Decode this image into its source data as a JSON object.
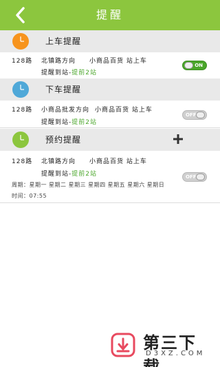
{
  "header": {
    "title": "提醒"
  },
  "sections": [
    {
      "title": "上车提醒",
      "clock_color": "#f7941d",
      "item": {
        "route": "128路",
        "direction": "北镇路方向",
        "station": "小商品百货 站上车",
        "remind_label": "提醒到站-",
        "remind_value": "提前2站",
        "toggle": "ON"
      }
    },
    {
      "title": "下车提醒",
      "clock_color": "#4fa8d8",
      "item": {
        "route": "128路",
        "direction": "小商品批发方向",
        "station": "小商品百货 站上车",
        "remind_label": "提醒到站-",
        "remind_value": "提前2站",
        "toggle": "OFF"
      }
    },
    {
      "title": "预约提醒",
      "clock_color": "#8cc63e",
      "add_label": "+",
      "item": {
        "route": "128路",
        "direction": "北镇路方向",
        "station": "小商品百货 站上车",
        "remind_label": "提醒到站-",
        "remind_value": "提前2站",
        "week": "周期：星期一 星期二 星期三 星期四 星期五 星期六 星期日",
        "time": "时间：07:55",
        "toggle": "OFF"
      }
    }
  ],
  "watermark": {
    "title": "第三下载",
    "subtitle": "D3XZ.COM"
  },
  "colors": {
    "header": "#8cc63e",
    "accent_green": "#4aa62a",
    "section_bg": "#e9e9e9"
  }
}
